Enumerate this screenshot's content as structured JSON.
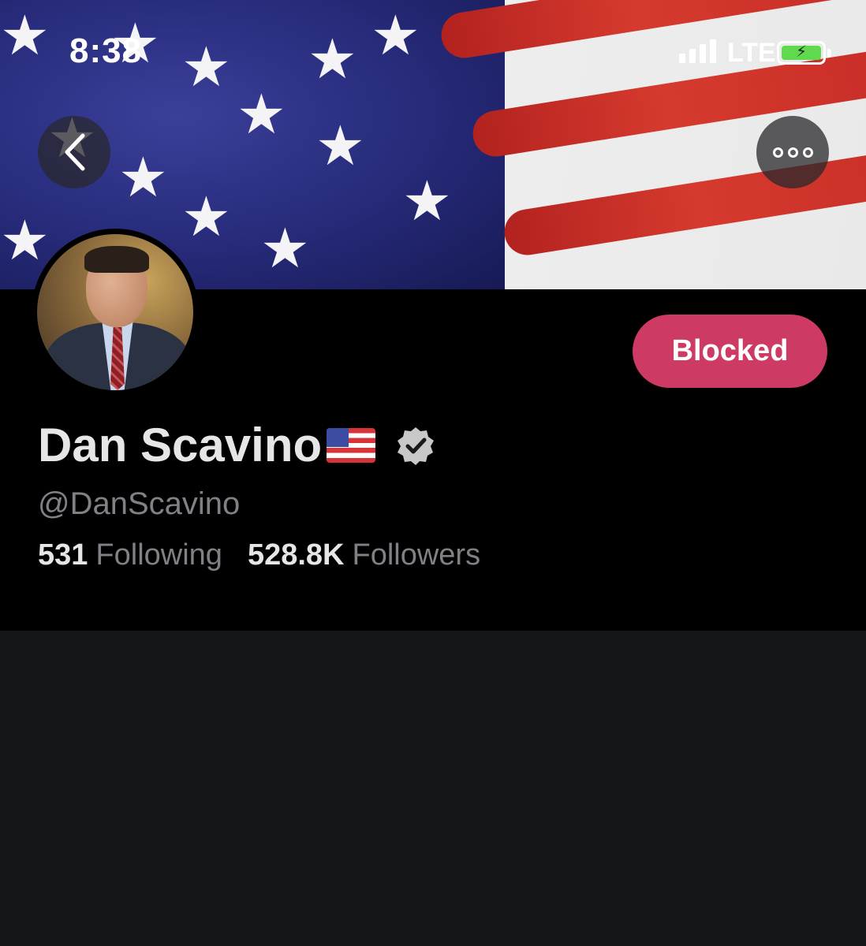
{
  "status_bar": {
    "time": "8:38",
    "network": "LTE",
    "battery_color": "#5fd94e"
  },
  "nav": {
    "back_icon": "chevron-left-icon",
    "more_icon": "ellipsis-icon"
  },
  "profile": {
    "name": "Dan Scavino",
    "name_emoji": "us-flag-emoji",
    "verified": true,
    "handle": "@DanScavino",
    "following_count": "531",
    "following_label": "Following",
    "followers_count": "528.8K",
    "followers_label": "Followers",
    "action_button": "Blocked",
    "action_button_color": "#cd3a63"
  }
}
